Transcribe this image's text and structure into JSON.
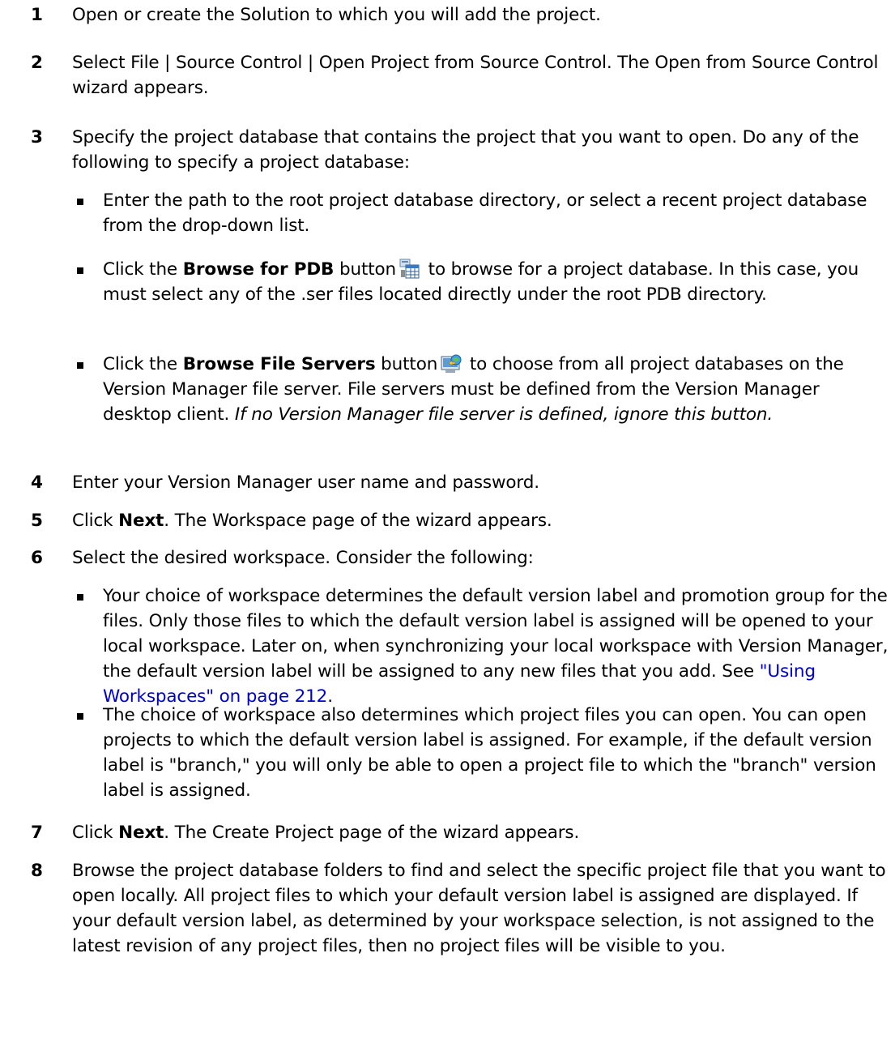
{
  "steps": {
    "s1": {
      "num": "1",
      "text": "Open or create the Solution to which you will add the project."
    },
    "s2": {
      "num": "2",
      "text": "Select File | Source Control | Open Project from Source Control. The Open from Source Control wizard appears."
    },
    "s3": {
      "num": "3",
      "text": "Specify the project database that contains the project that you want to open. Do any of the following to specify a project database:"
    },
    "s4": {
      "num": "4",
      "text": "Enter your Version Manager user name and password."
    },
    "s5": {
      "num": "5",
      "pre": "Click ",
      "bold": "Next",
      "post": ". The Workspace page of the wizard appears."
    },
    "s6": {
      "num": "6",
      "text": "Select the desired workspace. Consider the following:"
    },
    "s7": {
      "num": "7",
      "pre": "Click ",
      "bold": "Next",
      "post": ". The Create Project page of the wizard appears."
    },
    "s8": {
      "num": "8",
      "text": "Browse the project database folders to find and select the specific project file that you want to open locally. All project files to which your default version label is assigned are displayed. If your default version label, as determined by your workspace selection, is not assigned to the latest revision of any project files, then no project files will be visible to you."
    }
  },
  "bullets3": {
    "b1": {
      "text": "Enter the path to the root project database directory, or select a recent project database from the drop-down list."
    },
    "b2": {
      "pre": "Click the ",
      "bold": "Browse for PDB",
      "mid": " button",
      "post": " to browse for a project database. In this case, you must select any of the .ser files located directly under the root PDB directory.",
      "icon": "browse-pdb-icon"
    },
    "b3": {
      "pre": "Click the ",
      "bold": "Browse File Servers",
      "mid": " button",
      "post": " to choose from all project databases on the Version Manager file server. File servers must be defined from the Version Manager desktop client. ",
      "italic": "If no Version Manager file server is defined, ignore this button.",
      "icon": "browse-file-servers-icon"
    }
  },
  "bullets6": {
    "b1": {
      "text": "Your choice of workspace determines the default version label and promotion group for the files. Only those files to which the default version label is assigned will be opened to your local workspace. Later on, when synchronizing your local workspace with Version Manager, the default version label will be assigned to any new files that you add. See ",
      "link": "\"Using Workspaces\" on page 212",
      "post": "."
    },
    "b2": {
      "text": "The choice of workspace also determines which project files you can open. You can open projects to which the default version label is assigned. For example, if the default version label is \"branch,\" you will only be able to open a project file to which the \"branch\" version label is assigned."
    }
  },
  "colors": {
    "text": "#000000",
    "link": "#0000cc"
  }
}
